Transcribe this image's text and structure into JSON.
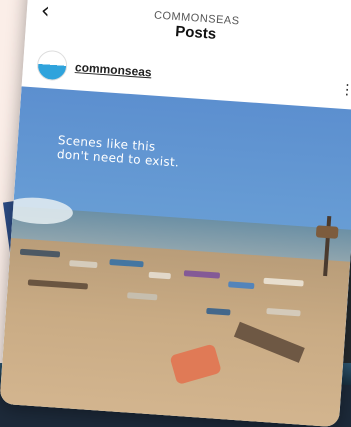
{
  "header": {
    "account": "COMMONSEAS",
    "title": "Posts",
    "back_icon": "chevron-left-icon"
  },
  "post": {
    "username": "commonseas",
    "more_icon": "more-icon",
    "caption_line1": "Scenes like this",
    "caption_line2": "don't need to exist."
  }
}
